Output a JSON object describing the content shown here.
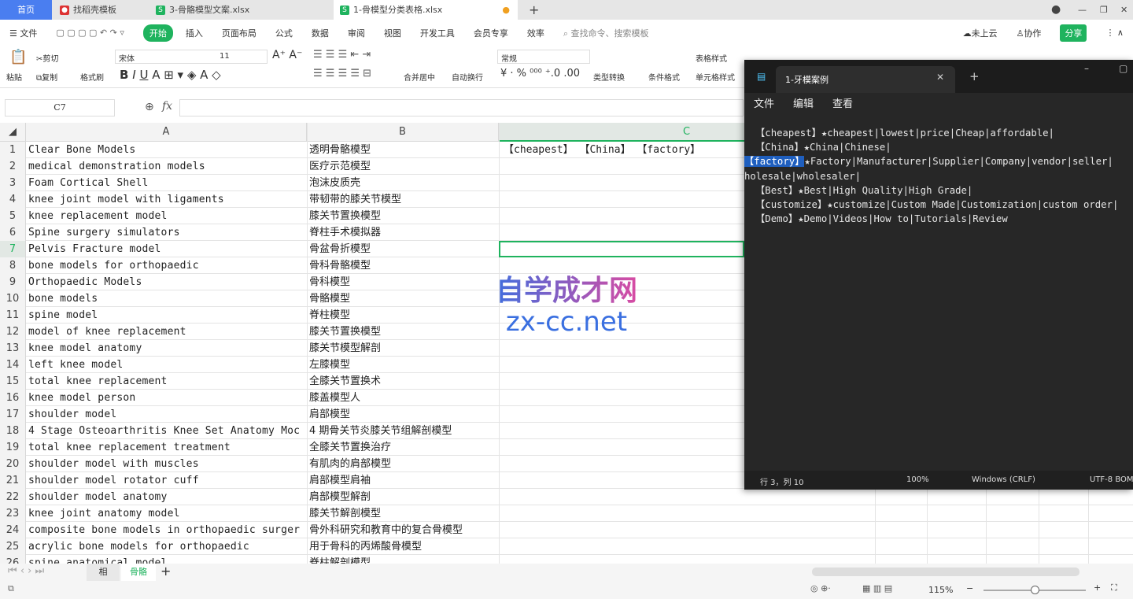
{
  "tabs": [
    {
      "label": "首页",
      "active": false
    },
    {
      "label": "找稻壳模板"
    },
    {
      "label": "3-骨骼模型文案.xlsx"
    },
    {
      "label": "1-骨模型分类表格.xlsx",
      "active": true
    }
  ],
  "menu": {
    "file": "文件",
    "items": [
      "开始",
      "插入",
      "页面布局",
      "公式",
      "数据",
      "审阅",
      "视图",
      "开发工具",
      "会员专享",
      "效率"
    ],
    "search_placeholder": "查找命令、搜索模板",
    "cloud": "未上云",
    "collab": "协作",
    "share": "分享"
  },
  "ribbon": {
    "paste": "粘贴",
    "cut": "剪切",
    "copy": "复制",
    "format_painter": "格式刷",
    "font": "宋体",
    "size": "11",
    "merge": "合并居中",
    "wrap": "自动换行",
    "number_format": "常规",
    "convert": "类型转换",
    "cond_format": "条件格式",
    "table_style": "表格样式",
    "cell_style": "单元格样式"
  },
  "formula": {
    "cell_ref": "C7",
    "fx": "fx",
    "value": ""
  },
  "columns": [
    "A",
    "B",
    "C"
  ],
  "rows": [
    {
      "n": "1",
      "a": "Clear Bone Models",
      "b": "透明骨骼模型",
      "c": "【cheapest】 【China】 【factory】"
    },
    {
      "n": "2",
      "a": "medical demonstration models",
      "b": "医疗示范模型"
    },
    {
      "n": "3",
      "a": "Foam Cortical Shell",
      "b": "泡沫皮质壳"
    },
    {
      "n": "4",
      "a": "knee joint model with ligaments",
      "b": "带韧带的膝关节模型"
    },
    {
      "n": "5",
      "a": "knee replacement model",
      "b": "膝关节置换模型"
    },
    {
      "n": "6",
      "a": "Spine surgery simulators",
      "b": "脊柱手术模拟器"
    },
    {
      "n": "7",
      "a": "Pelvis Fracture model",
      "b": "骨盆骨折模型"
    },
    {
      "n": "8",
      "a": "bone models for orthopaedic",
      "b": "骨科骨骼模型"
    },
    {
      "n": "9",
      "a": "Orthopaedic Models",
      "b": "骨科模型"
    },
    {
      "n": "10",
      "a": "bone models",
      "b": "骨骼模型"
    },
    {
      "n": "11",
      "a": "spine model",
      "b": "脊柱模型"
    },
    {
      "n": "12",
      "a": "model of knee replacement",
      "b": "膝关节置换模型"
    },
    {
      "n": "13",
      "a": "knee model anatomy",
      "b": "膝关节模型解剖"
    },
    {
      "n": "14",
      "a": "left knee model",
      "b": "左膝模型"
    },
    {
      "n": "15",
      "a": "total knee replacement",
      "b": "全膝关节置换术"
    },
    {
      "n": "16",
      "a": "knee model person",
      "b": "膝盖模型人"
    },
    {
      "n": "17",
      "a": "shoulder model",
      "b": "肩部模型"
    },
    {
      "n": "18",
      "a": "4 Stage Osteoarthritis Knee Set Anatomy Moc",
      "b": "4 期骨关节炎膝关节组解剖模型"
    },
    {
      "n": "19",
      "a": "total knee replacement treatment",
      "b": "全膝关节置换治疗"
    },
    {
      "n": "20",
      "a": "shoulder model with muscles",
      "b": "有肌肉的肩部模型"
    },
    {
      "n": "21",
      "a": "shoulder model rotator cuff",
      "b": "肩部模型肩袖"
    },
    {
      "n": "22",
      "a": "shoulder model anatomy",
      "b": "肩部模型解剖"
    },
    {
      "n": "23",
      "a": "knee joint anatomy model",
      "b": "膝关节解剖模型"
    },
    {
      "n": "24",
      "a": "composite bone models in orthopaedic surger",
      "b": "骨外科研究和教育中的复合骨模型"
    },
    {
      "n": "25",
      "a": "acrylic bone models for orthopaedic",
      "b": "用于骨科的丙烯酸骨模型"
    },
    {
      "n": "26",
      "a": "spine anatomical model",
      "b": "脊柱解剖模型"
    }
  ],
  "sheets": [
    {
      "label": "相"
    },
    {
      "label": "骨骼",
      "active": true
    }
  ],
  "status": {
    "zoom": "115%"
  },
  "notepad": {
    "title": "1-牙模案例",
    "menu": [
      "文件",
      "编辑",
      "查看"
    ],
    "lines": [
      "【cheapest】★cheapest|lowest|price|Cheap|affordable|",
      "【China】★China|Chinese|",
      "★Factory|Manufacturer|Supplier|Company|vendor|seller|",
      "holesale|wholesaler|",
      "【Best】★Best|High Quality|High Grade|",
      "【customize】★customize|Custom Made|Customization|custom order|",
      "【Demo】★Demo|Videos|How to|Tutorials|Review"
    ],
    "selected": "【factory】",
    "status": {
      "pos": "行 3，列 10",
      "zoom": "100%",
      "eol": "Windows (CRLF)",
      "enc": "UTF-8 BOM"
    }
  },
  "watermark": {
    "cn": "自学成才网",
    "url": "zx-cc.net"
  },
  "colors": {
    "accent": "#1fb35e",
    "home_tab": "#4a7ef0",
    "selection": "#1f5fbf"
  }
}
